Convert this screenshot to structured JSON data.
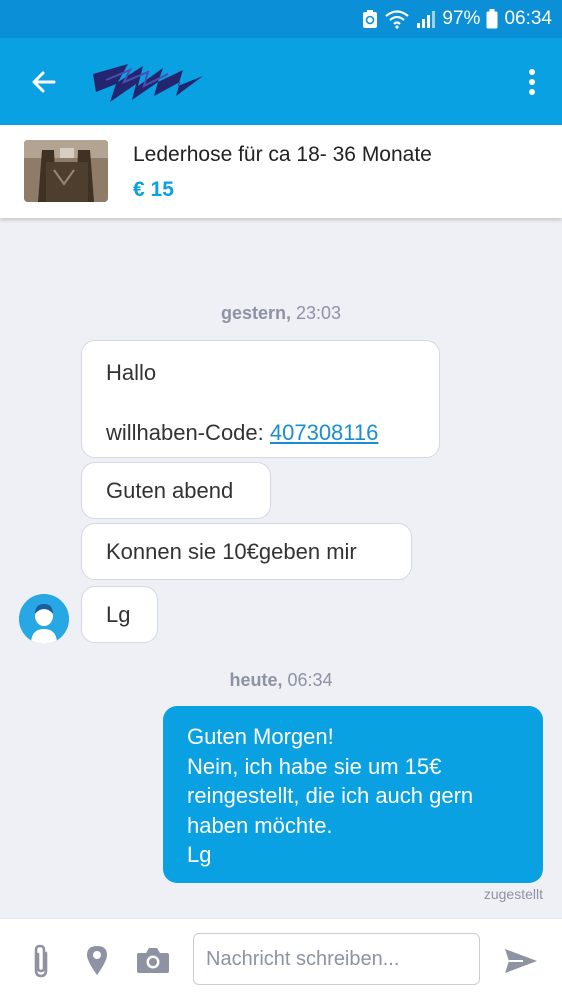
{
  "status_bar": {
    "battery": "97%",
    "time": "06:34"
  },
  "colors": {
    "primary": "#0aa1e2",
    "status_bar": "#0b8fd6",
    "background": "#eff0f5"
  },
  "icons": {
    "back": "arrow-left-icon",
    "more": "more-vertical-icon",
    "attach": "paperclip-icon",
    "location": "location-pin-icon",
    "camera": "camera-icon",
    "send": "send-icon"
  },
  "item": {
    "title": "Lederhose für ca 18- 36 Monate",
    "price": "€ 15"
  },
  "chat": {
    "day1": {
      "label": "gestern,",
      "time": "23:03"
    },
    "msg1": {
      "line1": "Hallo",
      "code_label": "willhaben-Code: ",
      "code": "407308116"
    },
    "msg2": "Guten abend",
    "msg3": "Konnen sie 10€geben mir",
    "msg4": "Lg",
    "day2": {
      "label": "heute,",
      "time": "06:34"
    },
    "reply": {
      "lines": [
        "Guten Morgen!",
        "Nein, ich habe sie um 15€",
        "reingestellt, die ich auch gern",
        "haben möchte.",
        "Lg"
      ]
    },
    "delivered": "zugestellt"
  },
  "input": {
    "placeholder": "Nachricht schreiben..."
  }
}
